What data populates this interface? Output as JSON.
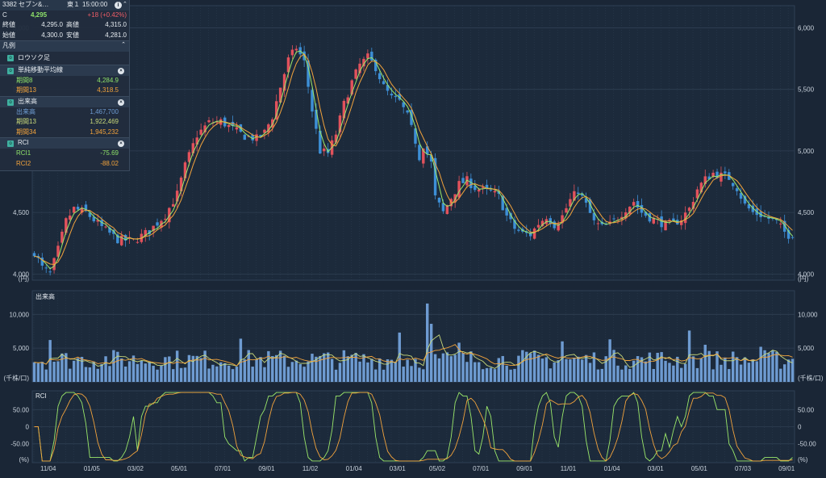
{
  "quote": {
    "title": "3382 セブン&…",
    "market": "東１",
    "time": "15:00:00",
    "label_c": "C",
    "price": "4,295",
    "change": "+18 (+0.42%)",
    "close_label": "終値",
    "close": "4,295.0",
    "high_label": "高値",
    "high": "4,315.0",
    "open_label": "始値",
    "open": "4,300.0",
    "low_label": "安値",
    "low": "4,281.0"
  },
  "legend": {
    "title": "凡例",
    "candle": "ロウソク足",
    "sma": {
      "label": "単純移動平均線",
      "rows": [
        {
          "name": "期間8",
          "value": "4,284.9"
        },
        {
          "name": "期間13",
          "value": "4,318.5"
        }
      ]
    },
    "volume": {
      "label": "出来高",
      "rows": [
        {
          "name": "出来高",
          "value": "1,467,700"
        },
        {
          "name": "期間13",
          "value": "1,922,469"
        },
        {
          "name": "期間34",
          "value": "1,945,232"
        }
      ]
    },
    "rci": {
      "label": "RCI",
      "rows": [
        {
          "name": "RCI1",
          "value": "-75.69"
        },
        {
          "name": "RCI2",
          "value": "-88.02"
        }
      ]
    }
  },
  "colors": {
    "up": "#e2525c",
    "down": "#3d8fd6",
    "sma8": "#9be86a",
    "sma13": "#f2a33c",
    "volume": "#6e9bd1",
    "vol13": "#c9d97a",
    "vol34": "#f2a33c",
    "rci1": "#9be86a",
    "rci2": "#f2a33c",
    "grid": "#2f3f53",
    "text": "#c9d2dc"
  },
  "chart_data": [
    {
      "type": "candlestick",
      "title": "",
      "y_unit": "(円)",
      "ylim": [
        3950,
        6180
      ],
      "yticks": [
        "4,000",
        "4,500",
        "5,000",
        "5,500",
        "6,000"
      ],
      "ytick_values": [
        4000,
        4500,
        5000,
        5500,
        6000
      ],
      "xticks": [
        "11/04",
        "01/05",
        "03/02",
        "05/01",
        "07/01",
        "09/01",
        "11/02",
        "01/04",
        "03/01",
        "05/02",
        "07/01",
        "09/01",
        "11/01",
        "01/04",
        "03/01",
        "05/01",
        "07/03",
        "09/01"
      ],
      "series": [
        {
          "name": "期間8",
          "kind": "sma"
        },
        {
          "name": "期間13",
          "kind": "sma"
        }
      ],
      "close_trend": [
        [
          0,
          4180
        ],
        [
          2,
          4050
        ],
        [
          4,
          4000
        ],
        [
          6,
          4200
        ],
        [
          8,
          4430
        ],
        [
          10,
          4530
        ],
        [
          13,
          4500
        ],
        [
          17,
          4380
        ],
        [
          21,
          4280
        ],
        [
          25,
          4270
        ],
        [
          29,
          4350
        ],
        [
          33,
          4480
        ],
        [
          36,
          4650
        ],
        [
          38,
          4880
        ],
        [
          41,
          5130
        ],
        [
          44,
          5230
        ],
        [
          47,
          5240
        ],
        [
          50,
          5180
        ],
        [
          53,
          5120
        ],
        [
          56,
          5100
        ],
        [
          58,
          5150
        ],
        [
          60,
          5280
        ],
        [
          62,
          5520
        ],
        [
          64,
          5740
        ],
        [
          66,
          5840
        ],
        [
          68,
          5720
        ],
        [
          70,
          5330
        ],
        [
          72,
          5000
        ],
        [
          74,
          4980
        ],
        [
          76,
          5140
        ],
        [
          78,
          5380
        ],
        [
          80,
          5560
        ],
        [
          82,
          5700
        ],
        [
          84,
          5760
        ],
        [
          86,
          5680
        ],
        [
          88,
          5520
        ],
        [
          90,
          5430
        ],
        [
          92,
          5400
        ],
        [
          94,
          5280
        ],
        [
          96,
          5080
        ],
        [
          97,
          4950
        ],
        [
          98,
          5050
        ],
        [
          100,
          4900
        ],
        [
          101,
          4620
        ],
        [
          103,
          4500
        ],
        [
          105,
          4620
        ],
        [
          107,
          4730
        ],
        [
          109,
          4760
        ],
        [
          111,
          4700
        ],
        [
          113,
          4680
        ],
        [
          115,
          4670
        ],
        [
          117,
          4630
        ],
        [
          119,
          4470
        ],
        [
          121,
          4370
        ],
        [
          123,
          4330
        ],
        [
          125,
          4320
        ],
        [
          127,
          4410
        ],
        [
          129,
          4470
        ],
        [
          131,
          4400
        ],
        [
          133,
          4470
        ],
        [
          135,
          4600
        ],
        [
          137,
          4680
        ],
        [
          139,
          4560
        ],
        [
          141,
          4420
        ],
        [
          143,
          4380
        ],
        [
          145,
          4400
        ],
        [
          147,
          4460
        ],
        [
          149,
          4530
        ],
        [
          151,
          4590
        ],
        [
          153,
          4500
        ],
        [
          155,
          4460
        ],
        [
          157,
          4430
        ],
        [
          159,
          4400
        ],
        [
          161,
          4410
        ],
        [
          163,
          4450
        ],
        [
          165,
          4530
        ],
        [
          167,
          4690
        ],
        [
          169,
          4770
        ],
        [
          171,
          4820
        ],
        [
          173,
          4800
        ],
        [
          175,
          4780
        ],
        [
          177,
          4700
        ],
        [
          179,
          4560
        ],
        [
          181,
          4500
        ],
        [
          183,
          4480
        ],
        [
          185,
          4450
        ],
        [
          187,
          4420
        ],
        [
          189,
          4340
        ],
        [
          191,
          4295
        ]
      ]
    },
    {
      "type": "bar",
      "title": "出来高",
      "y_unit": "(千株/口)",
      "ylim": [
        0,
        13500
      ],
      "yticks": [
        "5,000",
        "10,000"
      ],
      "ytick_values": [
        5000,
        10000
      ],
      "series": [
        {
          "name": "出来高",
          "kind": "bar",
          "typical_range": [
            1800,
            4800
          ],
          "spikes": [
            [
              4,
              6200
            ],
            [
              52,
              6400
            ],
            [
              92,
              7300
            ],
            [
              99,
              11600
            ],
            [
              100,
              8600
            ],
            [
              107,
              5800
            ],
            [
              133,
              6000
            ],
            [
              145,
              6300
            ],
            [
              165,
              7600
            ],
            [
              169,
              5500
            ],
            [
              183,
              5200
            ]
          ]
        },
        {
          "name": "期間13",
          "kind": "line",
          "typical": 2400
        },
        {
          "name": "期間34",
          "kind": "line",
          "typical": 2300
        }
      ]
    },
    {
      "type": "line",
      "title": "RCI",
      "y_unit": "(%)",
      "ylim": [
        -105,
        105
      ],
      "yticks": [
        "-50.00",
        "0",
        "50.00"
      ],
      "ytick_values": [
        -50,
        0,
        50
      ],
      "series": [
        {
          "name": "RCI1",
          "period": 9
        },
        {
          "name": "RCI2",
          "period": 26
        }
      ]
    }
  ]
}
